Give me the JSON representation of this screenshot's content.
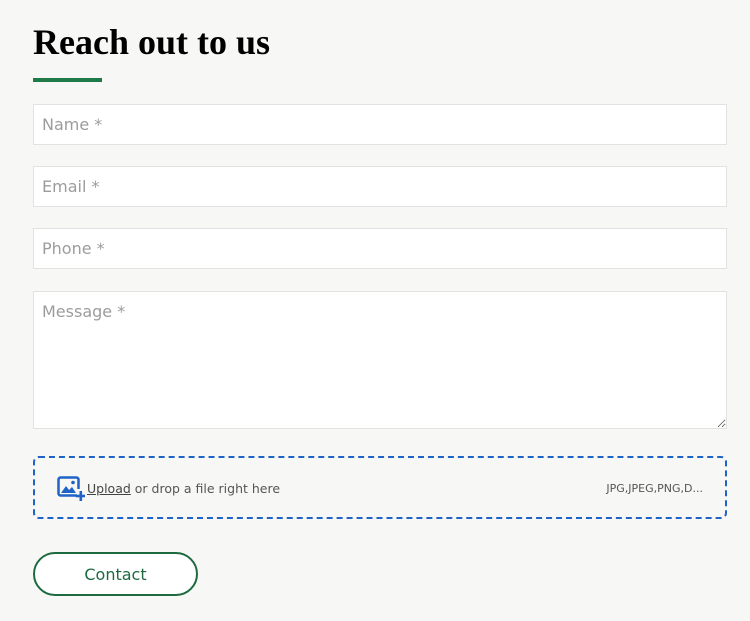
{
  "heading": "Reach out to us",
  "accent_color": "#1e7a46",
  "form": {
    "name_placeholder": "Name *",
    "email_placeholder": "Email *",
    "phone_placeholder": "Phone *",
    "message_placeholder": "Message *"
  },
  "upload": {
    "icon": "image-upload-icon",
    "link_text": "Upload",
    "rest_text": " or drop a file right here",
    "file_types": "JPG,JPEG,PNG,D...",
    "border_color": "#1f63c6"
  },
  "submit": {
    "label": "Contact",
    "color": "#1e6a40"
  }
}
